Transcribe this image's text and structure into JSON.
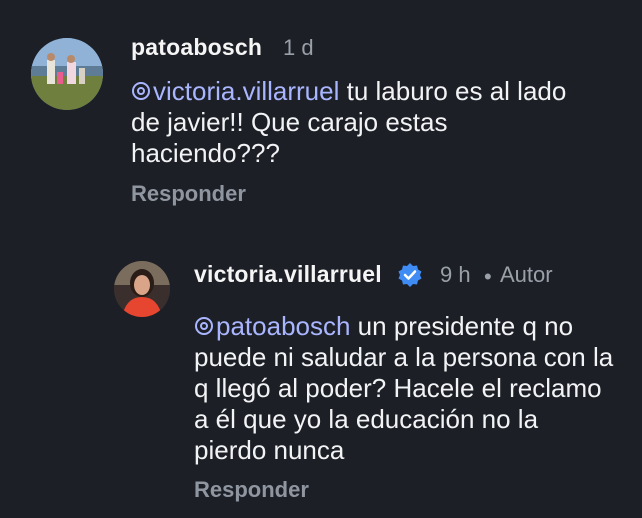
{
  "comment1": {
    "username": "patoabosch",
    "time": "1 d",
    "mention": "victoria.villarruel",
    "text": " tu laburo es al lado de javier!! Que carajo estas haciendo???",
    "reply_label": "Responder"
  },
  "comment2": {
    "username": "victoria.villarruel",
    "time": "9 h",
    "separator": "•",
    "author_label": "Autor",
    "mention": "patoabosch",
    "text": " un presidente q no puede ni saludar a la persona con la q llegó al poder? Hacele el reclamo a él que yo la educación no la pierdo nunca",
    "reply_label": "Responder"
  },
  "colors": {
    "background": "#1c1f26",
    "mention": "#a9b6ff",
    "muted": "#9aa0a8",
    "verified": "#3f8cf5"
  }
}
